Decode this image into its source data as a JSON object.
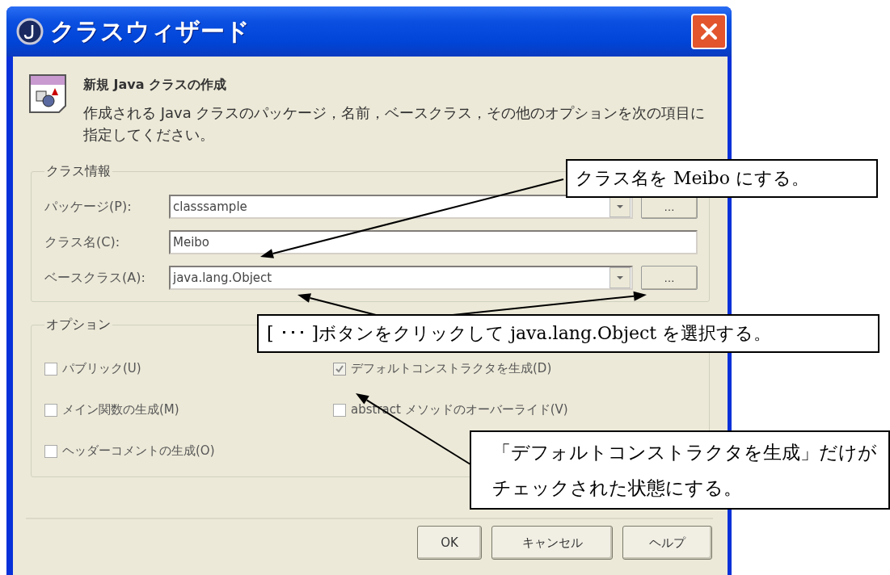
{
  "window": {
    "title": "クラスウィザード"
  },
  "header": {
    "title": "新規 Java クラスの作成",
    "description": "作成される Java クラスのパッケージ，名前，ベースクラス，その他のオプションを次の項目に指定してください。"
  },
  "class_info": {
    "legend": "クラス情報",
    "rows": [
      {
        "kind": "combo",
        "label": "パッケージ(P):",
        "value": "classsample",
        "browse_button": "…"
      },
      {
        "kind": "text",
        "label": "クラス名(C):",
        "value": "Meibo"
      },
      {
        "kind": "combo",
        "label": "ベースクラス(A):",
        "value": "java.lang.Object",
        "browse_button": "…"
      }
    ]
  },
  "options": {
    "legend": "オプション",
    "checkboxes": [
      {
        "label": "パブリック(U)",
        "checked": false
      },
      {
        "label": "デフォルトコンストラクタを生成(D)",
        "checked": true
      },
      {
        "label": "メイン関数の生成(M)",
        "checked": false
      },
      {
        "label": "abstract メソッドのオーバーライド(V)",
        "checked": false
      },
      {
        "label": "ヘッダーコメントの生成(O)",
        "checked": false
      }
    ]
  },
  "buttons": [
    "OK",
    "キャンセル",
    "ヘルプ"
  ],
  "annotations": [
    {
      "text": "クラス名を Meibo にする。"
    },
    {
      "text": "[ ･･･ ]ボタンをクリックして java.lang.Object を選択する。"
    },
    {
      "text": "「デフォルトコンストラクタを生成」だけがチェックされた状態にする。"
    }
  ]
}
